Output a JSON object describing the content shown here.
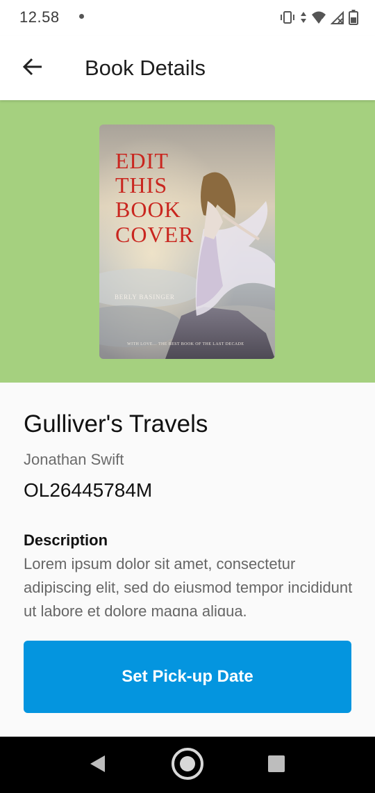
{
  "status_bar": {
    "time": "12.58"
  },
  "app_bar": {
    "title": "Book Details",
    "back_icon": "arrow-left-icon"
  },
  "cover": {
    "background_color": "#a5d07f",
    "title_lines": [
      "EDIT",
      "THIS",
      "BOOK",
      "COVER"
    ],
    "author": "BERLY BASINGER",
    "tagline": "WITH LOVE… THE BEST BOOK OF THE LAST DECADE"
  },
  "book": {
    "title": "Gulliver's Travels",
    "author": "Jonathan Swift",
    "id": "OL26445784M",
    "description_heading": "Description",
    "description": "Lorem ipsum dolor sit amet, consectetur adipiscing elit, sed do eiusmod tempor incididunt ut labore et dolore magna aliqua."
  },
  "actions": {
    "pickup_label": "Set Pick-up Date",
    "pickup_color": "#0495df"
  },
  "nav_bar": {
    "back_icon": "triangle-back-icon",
    "home_icon": "circle-home-icon",
    "recents_icon": "square-recents-icon"
  }
}
